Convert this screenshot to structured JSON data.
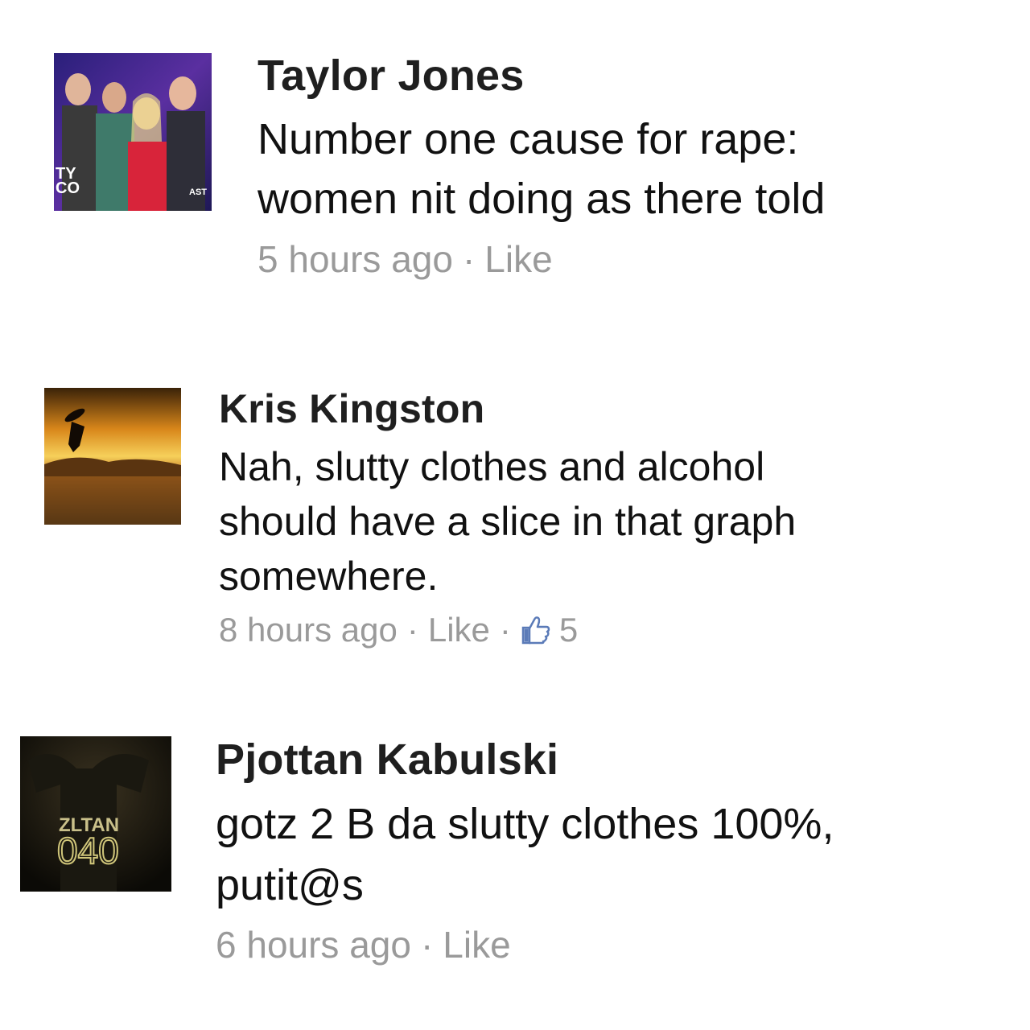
{
  "comments": [
    {
      "author": "Taylor Jones",
      "text": "Number one cause for rape:\nwomen nit doing as there told",
      "time": "5 hours ago",
      "like_label": "Like",
      "avatar_text": [
        "TY",
        "CO",
        "AST"
      ]
    },
    {
      "author": "Kris Kingston",
      "text": "Nah, slutty clothes and alcohol\nshould have a slice in that graph\nsomewhere.",
      "time": "8 hours ago",
      "like_label": "Like",
      "like_count": "5",
      "like_icon": "thumbs-up-icon"
    },
    {
      "author": "Pjottan Kabulski",
      "text": "gotz 2 B da slutty clothes 100%,\nputit@s",
      "time": "6 hours ago",
      "like_label": "Like",
      "avatar_text": [
        "ZLTAN",
        "040"
      ]
    }
  ],
  "colors": {
    "meta_gray": "#9a9a9a",
    "text": "#111111",
    "like_blue": "#5b7bb8"
  }
}
